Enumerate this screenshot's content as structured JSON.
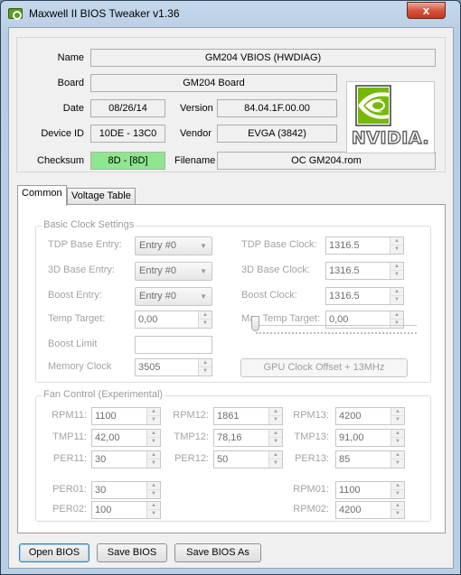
{
  "window": {
    "title": "Maxwell II BIOS Tweaker v1.36",
    "close_glyph": "x"
  },
  "header": {
    "name_label": "Name",
    "name_value": "GM204 VBIOS (HWDIAG)",
    "board_label": "Board",
    "board_value": "GM204 Board",
    "date_label": "Date",
    "date_value": "08/26/14",
    "version_label": "Version",
    "version_value": "84.04.1F.00.00",
    "device_id_label": "Device ID",
    "device_id_value": "10DE - 13C0",
    "vendor_label": "Vendor",
    "vendor_value": "EVGA (3842)",
    "checksum_label": "Checksum",
    "checksum_value": "8D - [8D]",
    "filename_label": "Filename",
    "filename_value": "OC GM204.rom",
    "logo_text": "NVIDIA."
  },
  "tabs": [
    {
      "label": "Common"
    },
    {
      "label": "Voltage Table"
    }
  ],
  "basic_clock": {
    "title": "Basic Clock Settings",
    "tdp_base_entry_label": "TDP Base Entry:",
    "tdp_base_entry_value": "Entry #0",
    "d3_base_entry_label": "3D Base Entry:",
    "d3_base_entry_value": "Entry #0",
    "boost_entry_label": "Boost Entry:",
    "boost_entry_value": "Entry #0",
    "temp_target_label": "Temp Target:",
    "temp_target_value": "0,00",
    "boost_limit_label": "Boost Limit",
    "memory_clock_label": "Memory Clock",
    "memory_clock_value": "3505",
    "tdp_base_clock_label": "TDP Base Clock:",
    "tdp_base_clock_value": "1316.5",
    "d3_base_clock_label": "3D Base Clock:",
    "d3_base_clock_value": "1316.5",
    "boost_clock_label": "Boost Clock:",
    "boost_clock_value": "1316.5",
    "max_temp_target_label": "Max Temp Target:",
    "max_temp_target_value": "0,00",
    "gpu_offset_button": "GPU Clock Offset + 13MHz",
    "gpu_offset_slider_level": 0
  },
  "fan_control": {
    "title": "Fan Control (Experimental)",
    "rpm11_label": "RPM11:",
    "rpm11_value": "1100",
    "rpm12_label": "RPM12:",
    "rpm12_value": "1861",
    "rpm13_label": "RPM13:",
    "rpm13_value": "4200",
    "tmp11_label": "TMP11:",
    "tmp11_value": "42,00",
    "tmp12_label": "TMP12:",
    "tmp12_value": "78,16",
    "tmp13_label": "TMP13:",
    "tmp13_value": "91,00",
    "per11_label": "PER11:",
    "per11_value": "30",
    "per12_label": "PER12:",
    "per12_value": "50",
    "per13_label": "PER13:",
    "per13_value": "85",
    "per01_label": "PER01:",
    "per01_value": "30",
    "per02_label": "PER02:",
    "per02_value": "100",
    "rpm01_label": "RPM01:",
    "rpm01_value": "1100",
    "rpm02_label": "RPM02:",
    "rpm02_value": "4200"
  },
  "buttons": {
    "open_bios": "Open BIOS",
    "save_bios": "Save BIOS",
    "save_bios_as": "Save BIOS As"
  },
  "icons": {
    "spin_up": "▲",
    "spin_down": "▼",
    "combo_arrow": "▼"
  },
  "colors": {
    "checksum_ok": "#8ee68e",
    "nvidia_green": "#76b900",
    "close_red": "#c3381e"
  }
}
